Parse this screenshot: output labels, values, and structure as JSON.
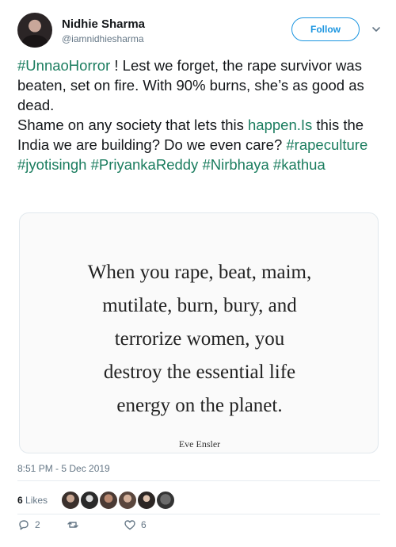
{
  "user": {
    "name": "Nidhie Sharma",
    "handle": "@iamnidhiesharma",
    "follow_label": "Follow"
  },
  "tweet": {
    "line1_tag": "#UnnaoHorror",
    "line1_rest": " ! Lest we forget, the rape survivor was beaten, set on fire. With 90% burns, she’s as good as dead.",
    "line2_start": "Shame on any society that lets this ",
    "line2_link": "happen.Is",
    "line2_rest": " this the India we are building? Do we even care? ",
    "hashtags": [
      "#rapeculture",
      "#jyotisingh",
      "#PriyankaReddy",
      "#Nirbhaya",
      "#kathua"
    ]
  },
  "quote": {
    "lines": [
      "When you rape, beat, maim,",
      "mutilate, burn, bury, and",
      "terrorize women, you",
      "destroy the essential life",
      "energy on the planet."
    ],
    "author": "Eve Ensler"
  },
  "timestamp": "8:51 PM - 5 Dec 2019",
  "likes": {
    "count": "6",
    "label": "Likes",
    "avatars": [
      "avatar-1",
      "avatar-2",
      "avatar-3",
      "avatar-4",
      "avatar-5",
      "avatar-6"
    ]
  },
  "actions": {
    "reply_count": "2",
    "retweet_count": "",
    "like_count": "6"
  },
  "colors": {
    "accent": "#1b95e0",
    "hashtag": "#1b7d5f",
    "muted": "#657786"
  }
}
